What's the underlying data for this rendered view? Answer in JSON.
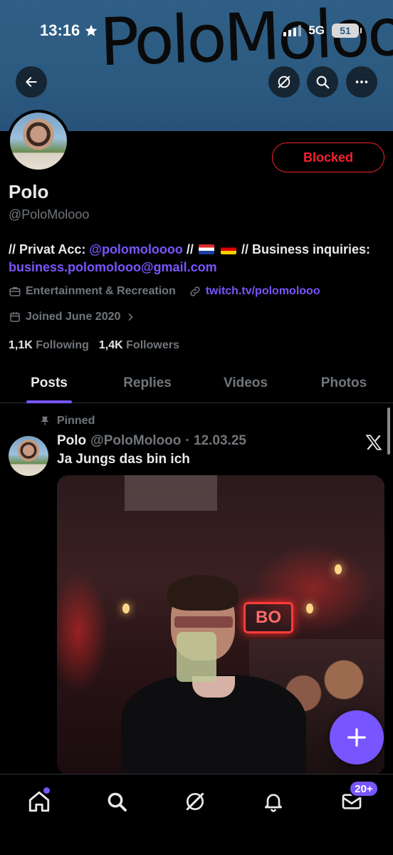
{
  "status_bar": {
    "time": "13:16",
    "network": "5G",
    "battery": "51"
  },
  "banner": {
    "handwriting": "PoloMolooo"
  },
  "header_actions": [
    "back-arrow-icon",
    "grok-icon",
    "search-icon",
    "more-icon"
  ],
  "profile": {
    "blocked_label": "Blocked",
    "name": "Polo",
    "handle": "@PoloMolooo",
    "bio": {
      "prefix": "// Privat Acc: ",
      "private_link": "@polomoloooo",
      "mid": " // ",
      "mid2": " // Business inquiries: ",
      "email": "business.polomolooo@gmail.com"
    },
    "category": "Entertainment & Recreation",
    "website": "twitch.tv/polomolooo",
    "joined": "Joined June 2020",
    "following_count": "1,1K",
    "following_label": "Following",
    "followers_count": "1,4K",
    "followers_label": "Followers"
  },
  "tabs": [
    {
      "label": "Posts",
      "active": true
    },
    {
      "label": "Replies",
      "active": false
    },
    {
      "label": "Videos",
      "active": false
    },
    {
      "label": "Photos",
      "active": false
    }
  ],
  "post": {
    "pinned_label": "Pinned",
    "author_name": "Polo",
    "author_handle": "@PoloMolooo",
    "date": "· 12.03.25",
    "text": "Ja Jungs das bin ich",
    "photo_sign": "BO"
  },
  "bottom_nav": {
    "items": [
      "home-icon",
      "search-icon",
      "grok-icon",
      "notifications-icon",
      "messages-icon"
    ],
    "messages_badge": "20+"
  },
  "colors": {
    "accent": "#7856ff",
    "blocked": "#f4212e",
    "muted": "#71767b",
    "text": "#e7e9ea"
  }
}
